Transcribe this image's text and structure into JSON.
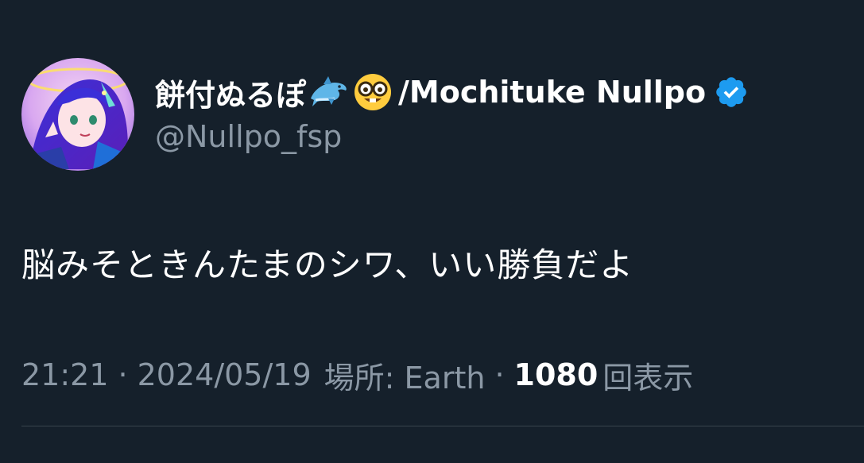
{
  "author": {
    "display_name": "餅付ぬるぽ",
    "emoji_1": "dolphin-emoji",
    "emoji_2": "nerd-face-emoji",
    "name_suffix": "/Mochituke Nullpo",
    "handle": "@Nullpo_fsp",
    "verified": true
  },
  "tweet": {
    "text": "脳みそときんたまのシワ、いい勝負だよ"
  },
  "meta": {
    "time": "21:21",
    "separator": "·",
    "date": "2024/05/19",
    "location": "場所: Earth",
    "views_count": "1080",
    "views_label": "回表示"
  },
  "colors": {
    "background": "#15202b",
    "primary_text": "#ffffff",
    "secondary_text": "#8b98a5",
    "verified_badge": "#1d9bf0",
    "divider": "#38444d"
  }
}
